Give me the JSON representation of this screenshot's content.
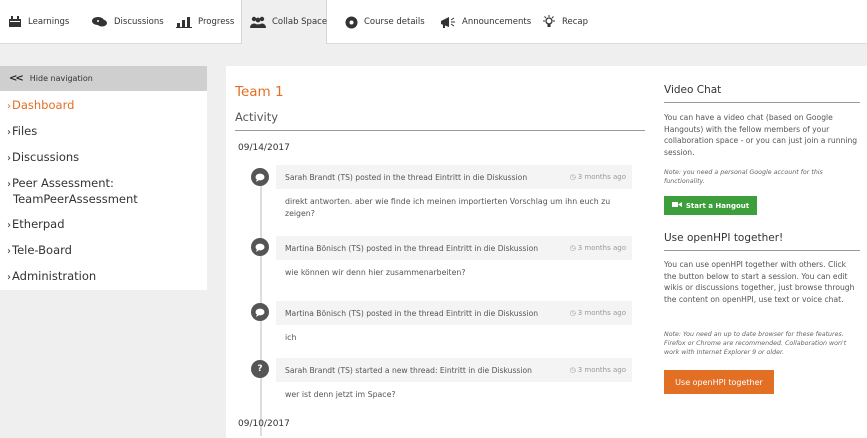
{
  "nav": {
    "tabs": [
      {
        "label": "Learnings",
        "icon": "learnings-icon"
      },
      {
        "label": "Discussions",
        "icon": "discussions-icon"
      },
      {
        "label": "Progress",
        "icon": "progress-icon"
      },
      {
        "label": "Collab Space",
        "icon": "collab-space-icon",
        "active": true
      },
      {
        "label": "Course details",
        "icon": "course-details-icon"
      },
      {
        "label": "Announcements",
        "icon": "announcements-icon"
      },
      {
        "label": "Recap",
        "icon": "recap-icon"
      }
    ]
  },
  "sidebar": {
    "hide_label": "Hide navigation",
    "items": [
      {
        "label": "Dashboard"
      },
      {
        "label": "Files"
      },
      {
        "label": "Discussions"
      },
      {
        "label": "Peer Assessment:",
        "label2": "TeamPeerAssessment"
      },
      {
        "label": "Etherpad"
      },
      {
        "label": "Tele-Board"
      },
      {
        "label": "Administration"
      }
    ]
  },
  "main": {
    "title": "Team 1",
    "activity_heading": "Activity",
    "dates": [
      "09/14/2017",
      "09/10/2017"
    ],
    "activities": [
      {
        "head": "Sarah Brandt (TS) posted in the thread Eintritt in die Diskussion",
        "time": "3 months ago",
        "body": "direkt antworten. aber wie finde ich meinen importierten Vorschlag um ihn euch zu",
        "body2": "zeigen?"
      },
      {
        "head": "Martina Bönisch (TS) posted in the thread Eintritt in die Diskussion",
        "time": "3 months ago",
        "body": "wie können wir denn hier zusammenarbeiten?"
      },
      {
        "head": "Martina Bönisch (TS) posted in the thread Eintritt in die Diskussion",
        "time": "3 months ago",
        "body": "ich"
      },
      {
        "head": "Sarah Brandt (TS) started a new thread: Eintritt in die Diskussion",
        "time": "3 months ago",
        "body": "wer ist denn jetzt im Space?"
      }
    ]
  },
  "right": {
    "video_heading": "Video Chat",
    "video_text": "You can have a video chat (based on Google Hangouts) with the fellow members of your collaboration space - or you can just join a running session.",
    "video_note": "Note: you need a personal Google account for this functionality.",
    "hangout_button": "Start a Hangout",
    "openhpi_heading": "Use openHPI together!",
    "openhpi_text": "You can use openHPI together with others. Click the button below to start a session. You can edit wikis or discussions together, just browse through the content on openHPI, use text or voice chat.",
    "openhpi_note": "Note: You need an up to date browser for these features. Firefox or Chrome are recommended. Collaboration won't work with Internet Explorer 9 or older.",
    "openhpi_button": "Use openHPI together"
  },
  "colors": {
    "accent": "#e36f24",
    "hangout_green": "#3c9f3c"
  }
}
